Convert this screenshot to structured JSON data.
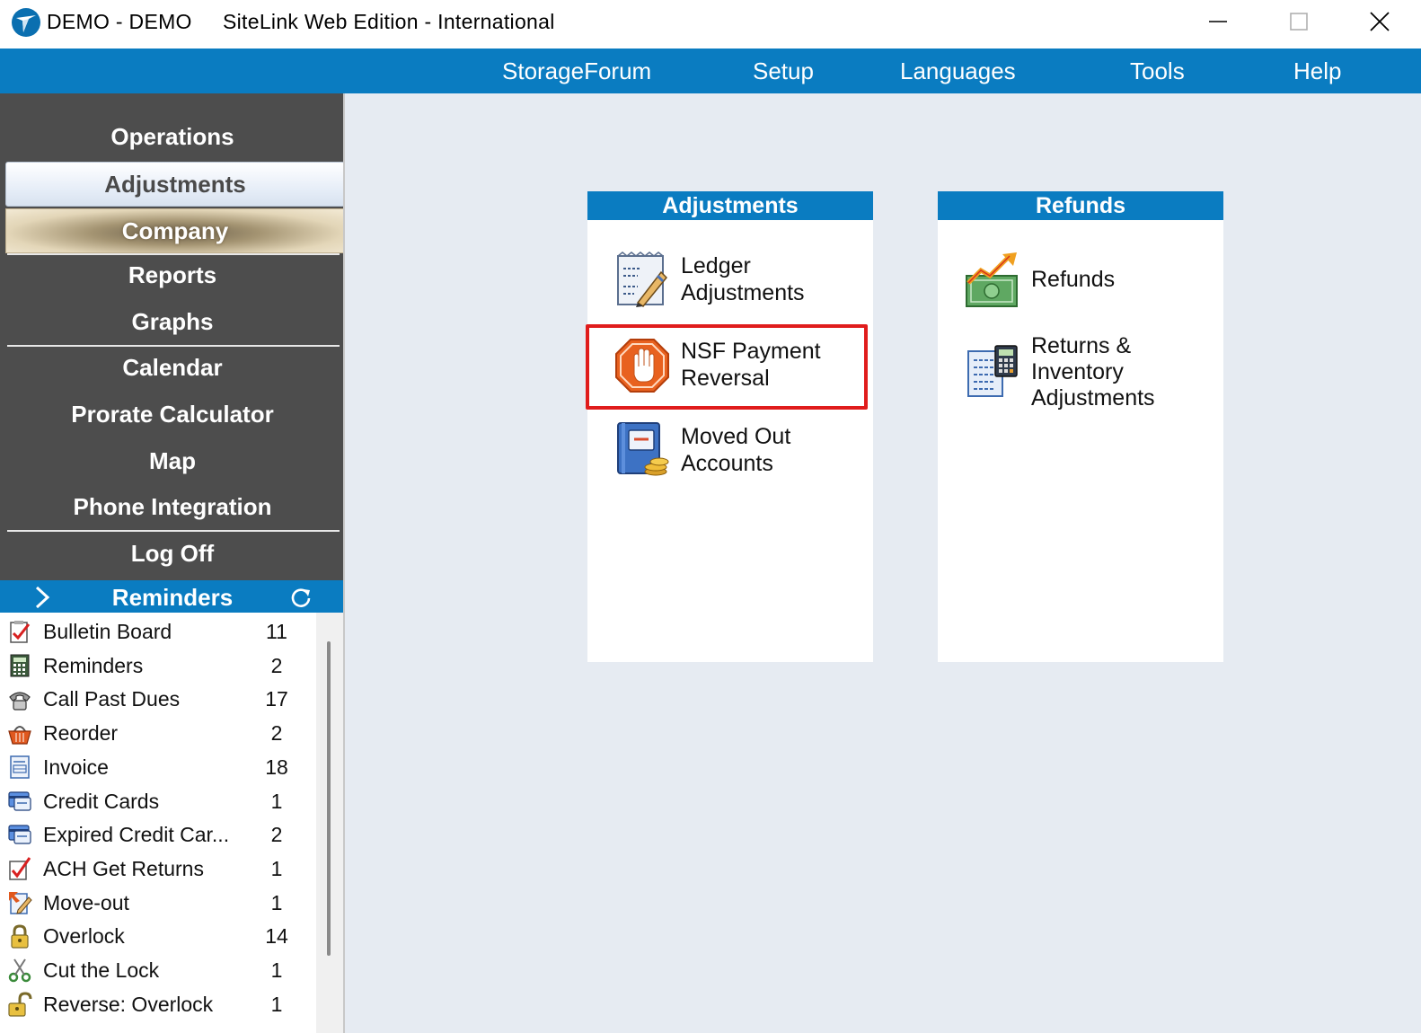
{
  "titlebar": {
    "app_name": "DEMO - DEMO",
    "caption": "SiteLink Web Edition - International",
    "controls": [
      "minimize-icon",
      "maximize-icon",
      "close-icon"
    ]
  },
  "menubar": {
    "items": [
      "StorageForum",
      "Setup",
      "Languages",
      "Tools",
      "Help"
    ]
  },
  "sidebar": {
    "nav": [
      "Operations",
      "Adjustments",
      "Company",
      "Reports",
      "Graphs",
      "Calendar",
      "Prorate Calculator",
      "Map",
      "Phone Integration",
      "Log Off"
    ],
    "selected": "Adjustments"
  },
  "reminders": {
    "title": "Reminders",
    "items": [
      {
        "label": "Bulletin Board",
        "count": "11",
        "icon": "bulletin-board-icon"
      },
      {
        "label": "Reminders",
        "count": "2",
        "icon": "calculator-icon"
      },
      {
        "label": "Call Past Dues",
        "count": "17",
        "icon": "phone-icon"
      },
      {
        "label": "Reorder",
        "count": "2",
        "icon": "basket-icon"
      },
      {
        "label": "Invoice",
        "count": "18",
        "icon": "invoice-icon"
      },
      {
        "label": "Credit Cards",
        "count": "1",
        "icon": "credit-card-icon"
      },
      {
        "label": "Expired Credit Car...",
        "count": "2",
        "icon": "credit-card-icon"
      },
      {
        "label": "ACH Get Returns",
        "count": "1",
        "icon": "checklist-icon"
      },
      {
        "label": "Move-out",
        "count": "1",
        "icon": "move-out-icon"
      },
      {
        "label": "Overlock",
        "count": "14",
        "icon": "lock-icon"
      },
      {
        "label": "Cut the Lock",
        "count": "1",
        "icon": "scissors-icon"
      },
      {
        "label": "Reverse: Overlock",
        "count": "1",
        "icon": "unlock-icon"
      }
    ]
  },
  "panels": {
    "adjustments": {
      "title": "Adjustments",
      "items": [
        {
          "line1": "Ledger",
          "line2": "Adjustments",
          "icon": "ledger-icon"
        },
        {
          "line1": "NSF Payment",
          "line2": "Reversal",
          "icon": "stop-hand-icon"
        },
        {
          "line1": "Moved Out",
          "line2": "Accounts",
          "icon": "moved-out-book-icon"
        }
      ]
    },
    "refunds": {
      "title": "Refunds",
      "items": [
        {
          "line1": "Refunds",
          "icon": "money-chart-icon"
        },
        {
          "line1": "Returns &",
          "line2": "Inventory",
          "line3": "Adjustments",
          "icon": "inventory-calculator-icon"
        }
      ]
    }
  },
  "colors": {
    "accent_blue": "#0a7cc1",
    "sidebar_bg": "#4d4d4d",
    "main_bg": "#e6ebf2",
    "highlight_red": "#e01c1c"
  }
}
